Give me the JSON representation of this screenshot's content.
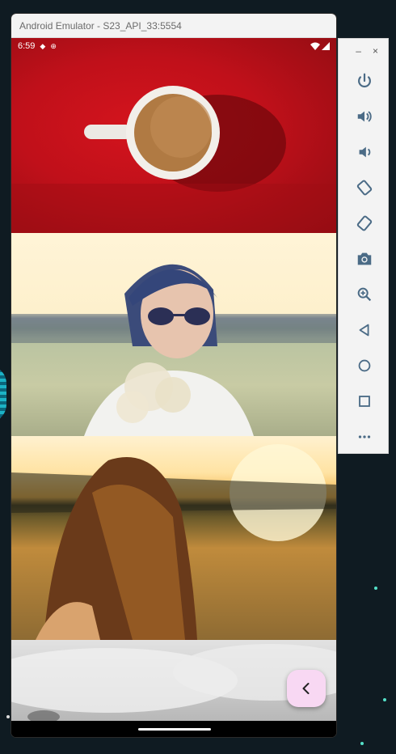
{
  "window": {
    "title": "Android Emulator - S23_API_33:5554"
  },
  "status_bar": {
    "time": "6:59"
  },
  "images": [
    {
      "label": "coffee-cup-on-red"
    },
    {
      "label": "woman-sunglasses-flowers"
    },
    {
      "label": "woman-sunset-field"
    },
    {
      "label": "grey-clouds"
    }
  ],
  "fab": {
    "icon": "chevron-left-icon",
    "color": "#f8d8f3"
  },
  "toolbar": {
    "minimize": "–",
    "close": "×",
    "buttons": [
      "power",
      "volume-up",
      "volume-down",
      "rotate-left",
      "rotate-right",
      "screenshot",
      "zoom",
      "back",
      "home",
      "overview",
      "more"
    ]
  }
}
